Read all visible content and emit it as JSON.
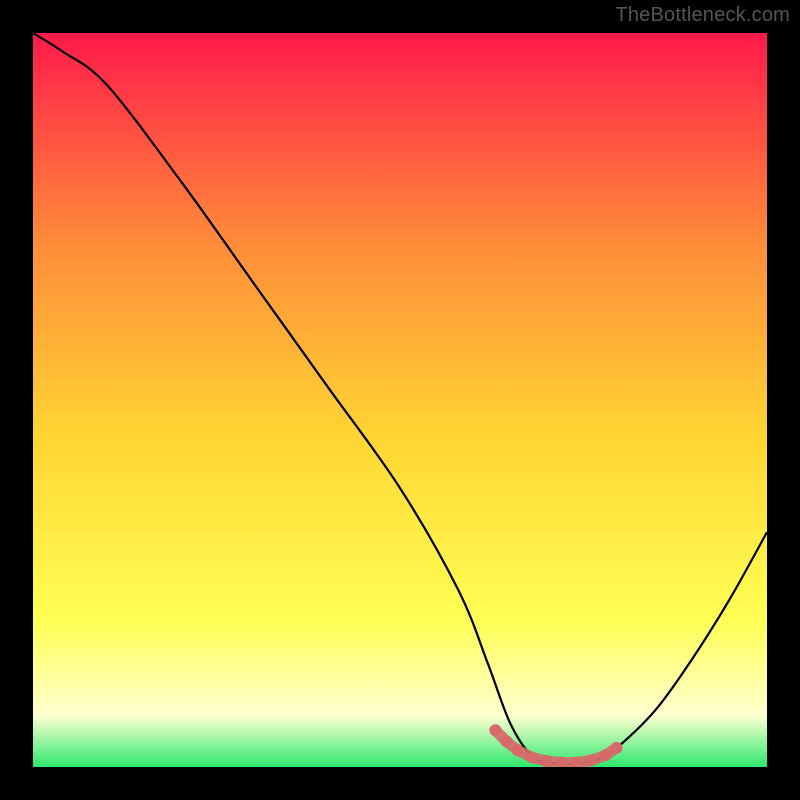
{
  "watermark": "TheBottleneck.com",
  "colors": {
    "page_bg": "#000000",
    "gradient_top": "#ff1a4b",
    "gradient_mid_upper": "#ff8a3a",
    "gradient_mid": "#ffd533",
    "gradient_lower": "#ffff55",
    "gradient_bottom_pale": "#ffffd0",
    "gradient_green": "#2ee86e",
    "curve_stroke": "#000000",
    "marker_fill": "#d66a6a"
  },
  "chart_data": {
    "type": "line",
    "title": "",
    "xlabel": "",
    "ylabel": "",
    "xlim": [
      0,
      100
    ],
    "ylim": [
      0,
      100
    ],
    "annotations": [],
    "series": [
      {
        "name": "curve",
        "x": [
          0,
          4,
          10,
          20,
          30,
          40,
          50,
          58,
          62,
          65,
          68,
          71,
          74,
          77,
          80,
          85,
          90,
          95,
          100
        ],
        "y": [
          100,
          97.5,
          93,
          80,
          66,
          52,
          38,
          24,
          14,
          6,
          1.5,
          0.5,
          0.5,
          1,
          3,
          8,
          15,
          23,
          32
        ]
      },
      {
        "name": "markers",
        "x": [
          63,
          64.5,
          66,
          68,
          70,
          72,
          74,
          76,
          78,
          79.5
        ],
        "y": [
          5,
          3.5,
          2.3,
          1.3,
          0.8,
          0.6,
          0.6,
          0.9,
          1.6,
          2.6
        ]
      }
    ]
  }
}
